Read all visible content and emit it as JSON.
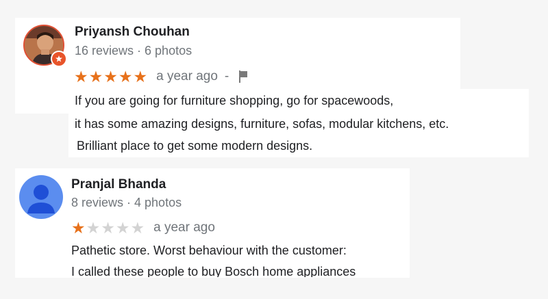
{
  "reviews": [
    {
      "name": "Priyansh Chouhan",
      "meta": "16 reviews · 6 photos",
      "rating": 5,
      "time": "a year ago",
      "separator": "-",
      "lines": [
        "If you are going for furniture shopping, go for spacewoods,",
        "it has some amazing designs, furniture, sofas, modular kitchens, etc.",
        "Brilliant place to  get some modern designs."
      ]
    },
    {
      "name": "Pranjal Bhanda",
      "meta": "8 reviews · 4 photos",
      "rating": 1,
      "time": "a year ago",
      "lines": [
        "Pathetic store. Worst behaviour with the customer:",
        "I called these people to buy Bosch home appliances"
      ]
    }
  ],
  "colors": {
    "star_on": "#e7711b",
    "star_off": "#d3d3d3",
    "badge": "#e8542a",
    "avatar_generic": "#5b8def"
  },
  "icons": {
    "badge": "local-guide-icon",
    "flag": "flag-icon",
    "avatar_generic": "person-icon"
  }
}
